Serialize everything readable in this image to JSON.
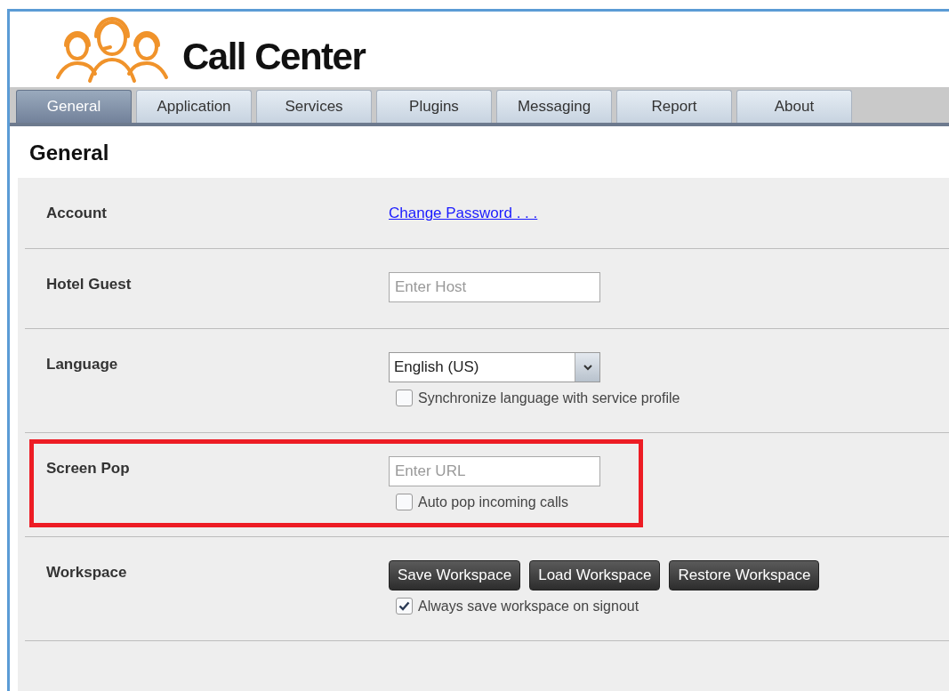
{
  "app": {
    "title": "Call Center"
  },
  "tabs": [
    {
      "label": "General",
      "selected": true
    },
    {
      "label": "Application",
      "selected": false
    },
    {
      "label": "Services",
      "selected": false
    },
    {
      "label": "Plugins",
      "selected": false
    },
    {
      "label": "Messaging",
      "selected": false
    },
    {
      "label": "Report",
      "selected": false
    },
    {
      "label": "About",
      "selected": false
    }
  ],
  "page": {
    "heading": "General"
  },
  "sections": [
    {
      "label": "Account",
      "highlighted": false,
      "controls": [
        {
          "kind": "link",
          "text": "Change Password . . ."
        }
      ]
    },
    {
      "label": "Hotel Guest",
      "highlighted": false,
      "controls": [
        {
          "kind": "input",
          "placeholder": "Enter Host"
        }
      ]
    },
    {
      "label": "Language",
      "highlighted": false,
      "controls": [
        {
          "kind": "select",
          "value": "English (US)"
        },
        {
          "kind": "checkbox",
          "label": "Synchronize language with service profile",
          "checked": false
        }
      ]
    },
    {
      "label": "Screen Pop",
      "highlighted": true,
      "controls": [
        {
          "kind": "input",
          "placeholder": "Enter URL"
        },
        {
          "kind": "checkbox",
          "label": "Auto pop incoming calls",
          "checked": false
        }
      ]
    },
    {
      "label": "Workspace",
      "highlighted": false,
      "controls": [
        {
          "kind": "buttons",
          "buttons": [
            "Save Workspace",
            "Load Workspace",
            "Restore Workspace"
          ]
        },
        {
          "kind": "checkbox",
          "label": "Always save workspace on signout",
          "checked": true
        }
      ]
    }
  ]
}
